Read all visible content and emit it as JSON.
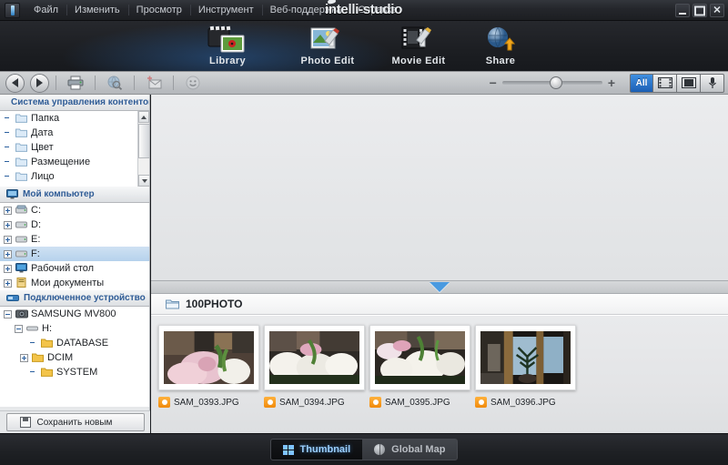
{
  "app": {
    "logo": "intelli-studio",
    "badge_icon": "app-logo-icon"
  },
  "menubar": {
    "items": [
      {
        "label": "Файл",
        "name": "menu-file"
      },
      {
        "label": "Изменить",
        "name": "menu-edit"
      },
      {
        "label": "Просмотр",
        "name": "menu-view"
      },
      {
        "label": "Инструмент",
        "name": "menu-tools"
      },
      {
        "label": "Веб-поддержка",
        "name": "menu-web-support"
      },
      {
        "label": "Справка",
        "name": "menu-help"
      }
    ],
    "window_controls": {
      "minimize": "minimize-button",
      "maximize": "maximize-button",
      "close": "close-button"
    }
  },
  "toolbar": {
    "items": [
      {
        "label": "Library",
        "icon": "library-icon",
        "active": true
      },
      {
        "label": "Photo Edit",
        "icon": "photo-edit-icon",
        "active": false
      },
      {
        "label": "Movie Edit",
        "icon": "movie-edit-icon",
        "active": false
      },
      {
        "label": "Share",
        "icon": "share-icon",
        "active": false
      }
    ]
  },
  "subbar": {
    "back": "back-button",
    "forward": "forward-button",
    "buttons": [
      {
        "name": "print-button",
        "icon": "printer-icon"
      },
      {
        "name": "search-web-button",
        "icon": "globe-search-icon"
      },
      {
        "name": "new-mail-button",
        "icon": "mail-add-icon"
      },
      {
        "name": "face-tag-button",
        "icon": "smiley-icon"
      }
    ],
    "zoom": {
      "minus": "−",
      "plus": "+",
      "value": 47
    },
    "filters": [
      {
        "label": "All",
        "name": "filter-all",
        "active": true
      },
      {
        "label": "",
        "name": "filter-video",
        "icon": "film-icon",
        "active": false
      },
      {
        "label": "",
        "name": "filter-photo",
        "icon": "photo-icon",
        "active": false
      },
      {
        "label": "",
        "name": "filter-audio",
        "icon": "microphone-icon",
        "active": false
      }
    ]
  },
  "sidebar": {
    "panels": [
      {
        "title": "Система управления контентоı",
        "icon": "folder-icon",
        "name": "content-management-panel",
        "items": [
          {
            "label": "Папка",
            "indent": 1,
            "expander": "none",
            "selected": false
          },
          {
            "label": "Дата",
            "indent": 1,
            "expander": "none",
            "selected": false
          },
          {
            "label": "Цвет",
            "indent": 1,
            "expander": "none",
            "selected": false
          },
          {
            "label": "Размещение",
            "indent": 1,
            "expander": "none",
            "selected": false
          },
          {
            "label": "Лицо",
            "indent": 1,
            "expander": "none",
            "selected": false
          }
        ]
      },
      {
        "title": "Мой компьютер",
        "icon": "computer-icon",
        "name": "my-computer-panel",
        "items": [
          {
            "label": "C:",
            "indent": 0,
            "expander": "plus",
            "selected": false
          },
          {
            "label": "D:",
            "indent": 0,
            "expander": "plus",
            "selected": false
          },
          {
            "label": "E:",
            "indent": 0,
            "expander": "plus",
            "selected": false
          },
          {
            "label": "F:",
            "indent": 0,
            "expander": "plus",
            "selected": true
          },
          {
            "label": "Рабочий стол",
            "indent": 0,
            "expander": "plus",
            "selected": false
          },
          {
            "label": "Мои документы",
            "indent": 0,
            "expander": "plus",
            "selected": false
          }
        ]
      },
      {
        "title": "Подключенное устройство",
        "icon": "device-icon",
        "name": "connected-device-panel",
        "items": [
          {
            "label": "SAMSUNG MV800",
            "indent": 0,
            "expander": "minus",
            "selected": false
          },
          {
            "label": "H:",
            "indent": 1,
            "expander": "minus",
            "selected": false
          },
          {
            "label": "DATABASE",
            "indent": 2,
            "expander": "none",
            "selected": false
          },
          {
            "label": "DCIM",
            "indent": 2,
            "expander": "plus",
            "selected": false
          },
          {
            "label": "SYSTEM",
            "indent": 2,
            "expander": "none",
            "selected": false
          }
        ]
      }
    ],
    "save_button": {
      "label": "Сохранить новым",
      "icon": "save-icon"
    }
  },
  "browser": {
    "folder": {
      "label": "100PHOTO",
      "icon": "folder-open-icon"
    },
    "files": [
      {
        "name": "SAM_0393.JPG",
        "icon": "camera-icon"
      },
      {
        "name": "SAM_0394.JPG",
        "icon": "camera-icon"
      },
      {
        "name": "SAM_0395.JPG",
        "icon": "camera-icon"
      },
      {
        "name": "SAM_0396.JPG",
        "icon": "camera-icon"
      }
    ]
  },
  "footer": {
    "tabs": [
      {
        "label": "Thumbnail",
        "icon": "grid-icon",
        "active": true
      },
      {
        "label": "Global Map",
        "icon": "globe-icon",
        "active": false
      }
    ]
  },
  "colors": {
    "accent_blue": "#2a7fd4",
    "selection_blue": "#b6d2ec",
    "panel_title": "#2f5c96",
    "camera_orange": "#f08a0c",
    "dark_chrome": "#1e2024"
  }
}
